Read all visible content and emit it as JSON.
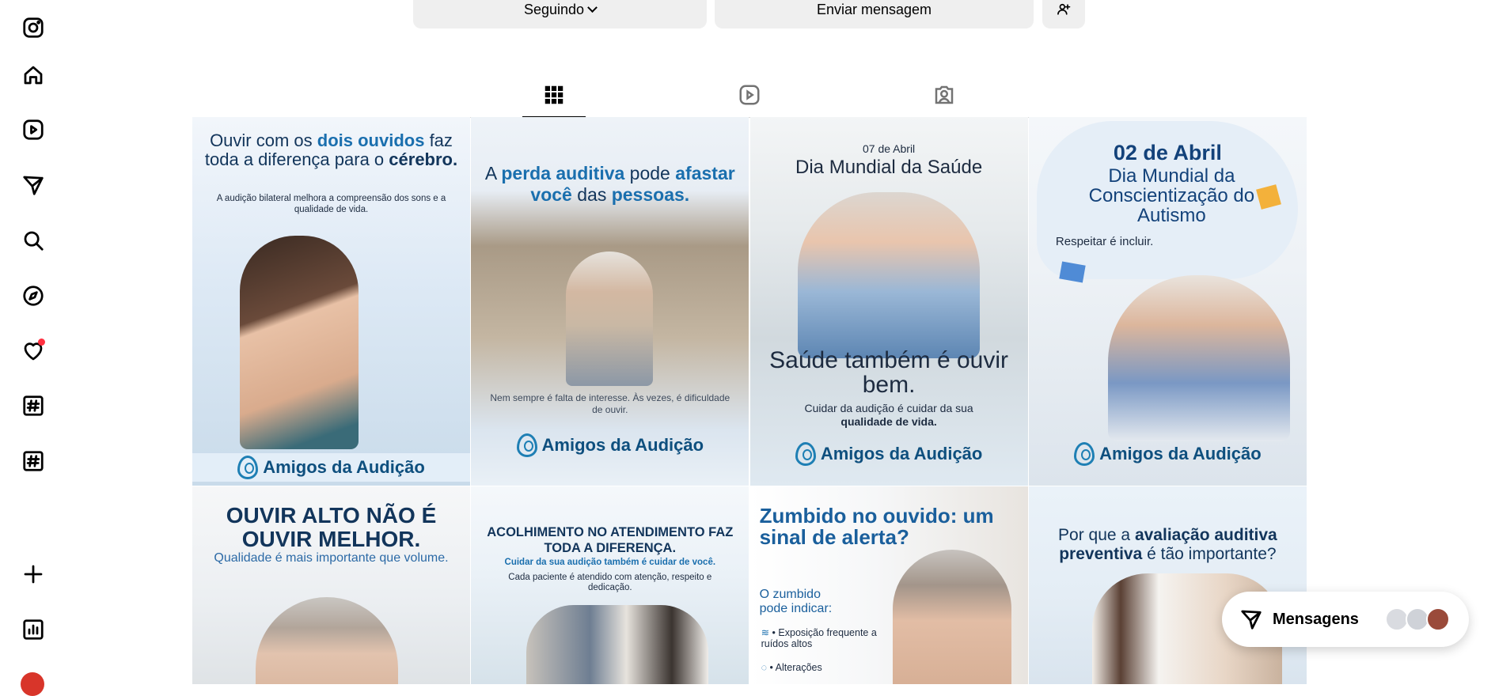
{
  "profile": {
    "following_label": "Seguindo",
    "message_label": "Enviar mensagem"
  },
  "posts": [
    {
      "title_a": "Ouvir com os ",
      "title_em": "dois ouvidos",
      "title_b": " faz toda a diferença para o ",
      "title_em2": "cérebro.",
      "subtitle": "A audição bilateral melhora a compreensão dos sons e a qualidade de vida.",
      "logo": "Amigos da Audição"
    },
    {
      "title_a": "A ",
      "title_em": "perda auditiva",
      "title_b": " pode ",
      "title_em2": "afastar você",
      "title_c": " das ",
      "title_em3": "pessoas.",
      "subtitle": "Nem sempre é falta de interesse. Às vezes, é dificuldade de ouvir.",
      "logo": "Amigos da Audição"
    },
    {
      "date": "07 de Abril",
      "title": "Dia Mundial da Saúde",
      "headline": "Saúde também é ouvir bem.",
      "subtitle_a": "Cuidar da audição é cuidar da sua ",
      "subtitle_em": "qualidade de vida.",
      "logo": "Amigos da Audição"
    },
    {
      "title": "02 de Abril",
      "subtitle": "Dia Mundial da Conscientização do Autismo",
      "tagline": "Respeitar é incluir.",
      "logo": "Amigos da Audição"
    },
    {
      "title": "OUVIR ALTO NÃO É OUVIR MELHOR.",
      "subtitle": "Qualidade é mais importante que volume."
    },
    {
      "title": "ACOLHIMENTO NO ATENDIMENTO FAZ TODA A DIFERENÇA.",
      "highlight": "Cuidar da sua audição também é cuidar de você.",
      "subtitle": "Cada paciente é atendido com atenção, respeito e dedicação."
    },
    {
      "title": "Zumbido no ouvido: um sinal de alerta?",
      "lead": "O zumbido pode indicar:",
      "bullets": [
        "Exposição frequente a ruídos altos",
        "Alterações"
      ]
    },
    {
      "title_a": "Por que a ",
      "title_em": "avaliação auditiva preventiva",
      "title_b": " é tão importante?"
    }
  ],
  "messages": {
    "label": "Mensagens"
  },
  "icons": {
    "sidebar": [
      "instagram-icon",
      "home-icon",
      "reels-icon",
      "messages-icon",
      "search-icon",
      "explore-icon",
      "notifications-icon",
      "hashtag-icon",
      "hashtag-icon",
      "create-icon",
      "dashboard-icon"
    ],
    "tabs": [
      "posts-grid-icon",
      "reels-tab-icon",
      "tagged-tab-icon"
    ]
  },
  "colors": {
    "notification": "#ff3040",
    "brand_blue": "#1a6fae"
  }
}
